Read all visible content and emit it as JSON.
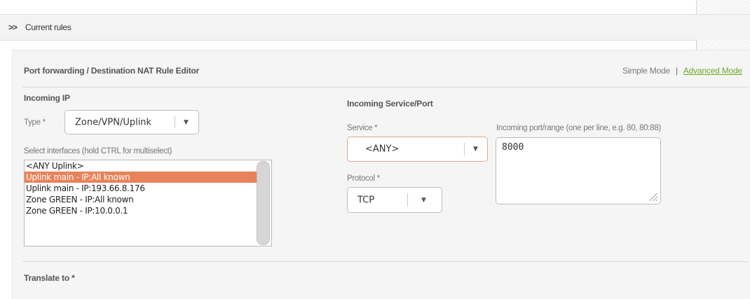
{
  "header": {
    "chevron": ">>",
    "title": "Current rules"
  },
  "editor": {
    "title": "Port forwarding / Destination NAT Rule Editor",
    "simple_mode": "Simple Mode",
    "separator": "|",
    "advanced_mode": "Advanced Mode"
  },
  "incoming_ip": {
    "section_label": "Incoming IP",
    "type_label": "Type *",
    "type_value": "Zone/VPN/Uplink",
    "interfaces_label": "Select interfaces (hold CTRL for multiselect)",
    "interfaces": [
      {
        "label": "<ANY Uplink>",
        "selected": false
      },
      {
        "label": "Uplink main - IP:All known",
        "selected": true
      },
      {
        "label": "Uplink main - IP:193.66.8.176",
        "selected": false
      },
      {
        "label": "Zone GREEN - IP:All known",
        "selected": false
      },
      {
        "label": "Zone GREEN - IP:10.0.0.1",
        "selected": false
      }
    ]
  },
  "incoming_service": {
    "section_label": "Incoming Service/Port",
    "service_label": "Service *",
    "service_value": "<ANY>",
    "port_label": "Incoming port/range (one per line, e.g. 80, 80:88)",
    "port_value": "8000",
    "protocol_label": "Protocol *",
    "protocol_value": "TCP"
  },
  "translate": {
    "section_label": "Translate to *"
  },
  "colors": {
    "accent_green": "#6aa92b",
    "selection_orange": "#e8825a",
    "service_border": "#e2a58f"
  },
  "icons": {
    "dropdown": "caret-down-icon",
    "expand": "double-chevron-icon"
  }
}
